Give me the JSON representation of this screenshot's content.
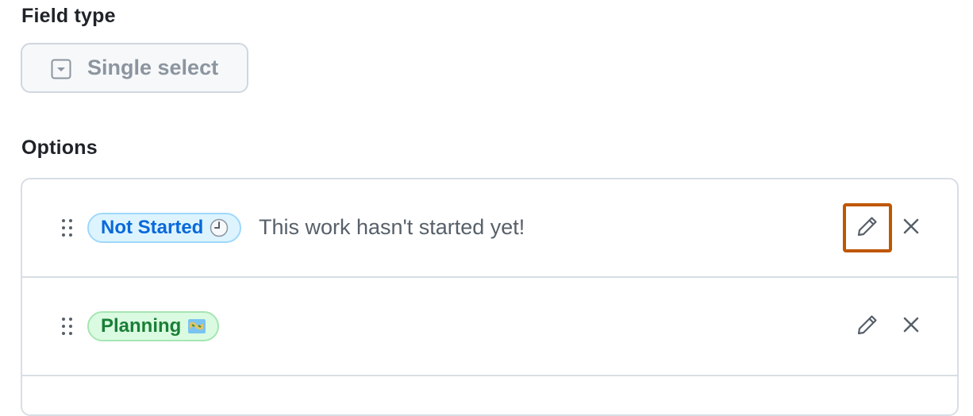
{
  "field_type": {
    "label": "Field type",
    "button_label": "Single select",
    "icon": "single-select-icon"
  },
  "options": {
    "label": "Options",
    "items": [
      {
        "name": "Not Started",
        "emoji": "clock-icon",
        "description": "This work hasn't started yet!",
        "color": "#0969da",
        "highlighted_edit": true
      },
      {
        "name": "Planning",
        "emoji": "map-icon",
        "description": "",
        "color": "#1a7f37",
        "highlighted_edit": false
      }
    ]
  },
  "colors": {
    "highlight": "#bf5700",
    "blue": "#0969da",
    "green": "#1a7f37"
  }
}
